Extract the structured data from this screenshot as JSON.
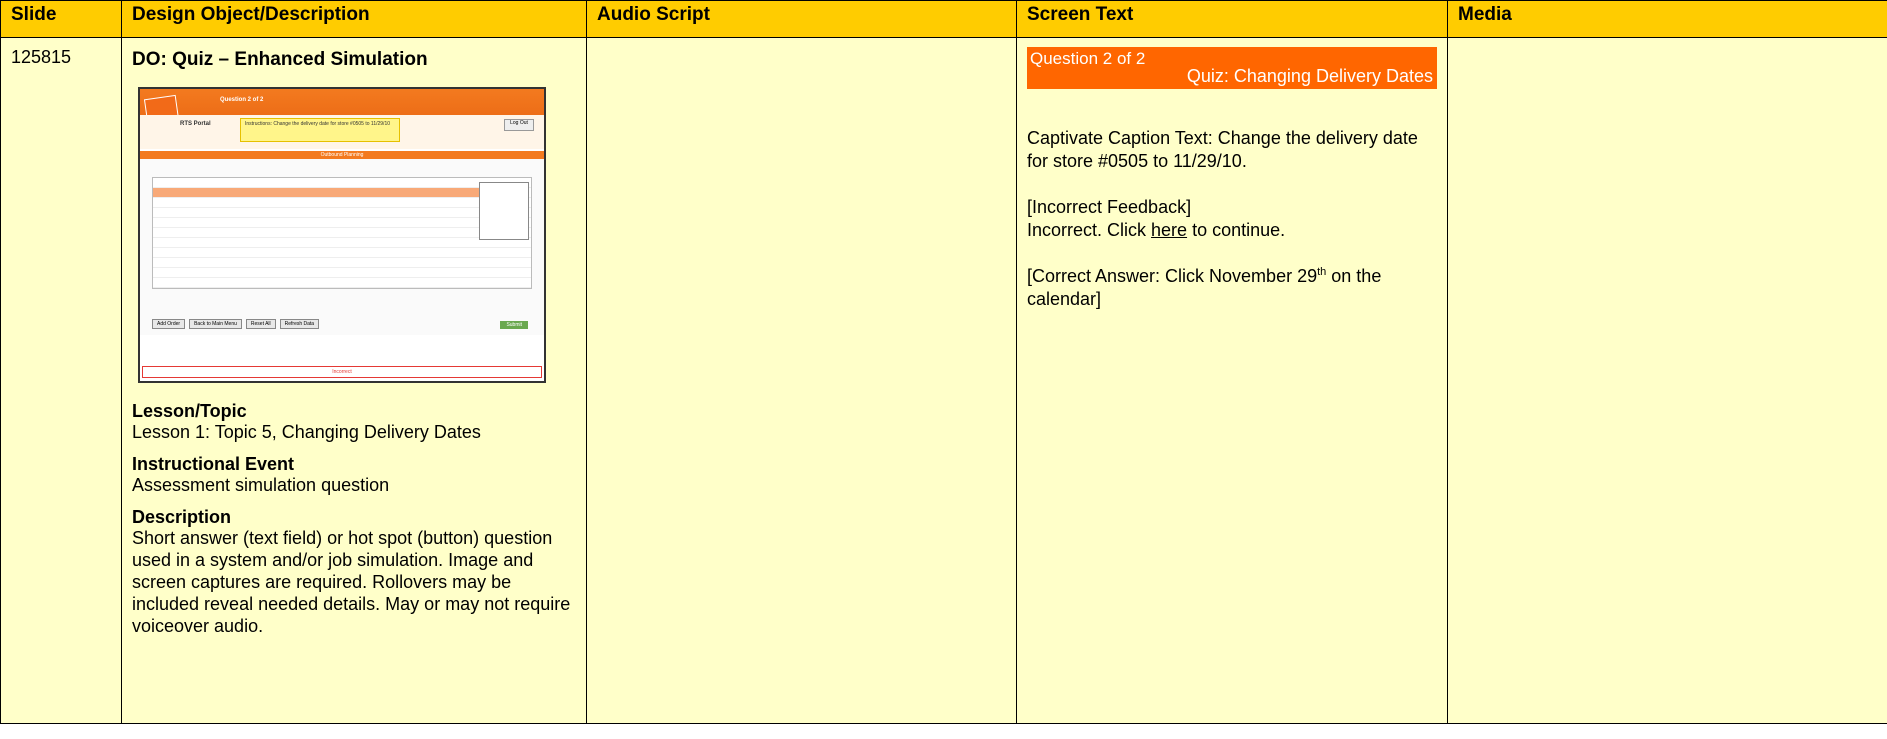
{
  "headers": {
    "slide": "Slide",
    "design": "Design Object/Description",
    "audio": "Audio Script",
    "screen": "Screen Text",
    "media": "Media"
  },
  "row": {
    "slide_number": "125815",
    "design": {
      "title": "DO: Quiz – Enhanced Simulation",
      "screenshot": {
        "question": "Question 2 of 2",
        "app_name": "RTS Portal",
        "instructions": "Instructions: Change the delivery date for store #0505 to 11/29/10",
        "logout": "Log Out",
        "band_title": "Outbound Planning",
        "buttons": [
          "Add Order",
          "Back to Main Menu",
          "Reset All",
          "Refresh Data"
        ],
        "submit": "Submit",
        "feedback": "Incorrect"
      },
      "lesson_heading": "Lesson/Topic",
      "lesson_text": "Lesson 1: Topic 5, Changing Delivery Dates",
      "event_heading": "Instructional Event",
      "event_text": "Assessment simulation question",
      "description_heading": "Description",
      "description_text": "Short answer (text field) or hot spot (button) question used in a system and/or job simulation. Image and screen captures are required. Rollovers may be included reveal needed details. May or may not require voiceover audio."
    },
    "audio_script": "",
    "screen_text": {
      "bar_question": "Question 2 of 2",
      "bar_title": "Quiz: Changing Delivery Dates",
      "caption": "Captivate Caption Text: Change the delivery date for store #0505 to 11/29/10.",
      "incorrect_label": "[Incorrect Feedback]",
      "incorrect_prefix": "Incorrect. Click ",
      "incorrect_link": "here",
      "incorrect_suffix": " to continue.",
      "correct_prefix": "[Correct Answer: Click November 29",
      "correct_sup": "th",
      "correct_suffix": " on the calendar]"
    },
    "media": ""
  }
}
